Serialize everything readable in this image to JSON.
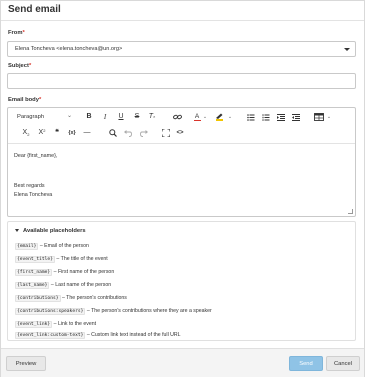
{
  "dialog": {
    "title": "Send email"
  },
  "from": {
    "label": "From",
    "required_mark": "*",
    "value": "Elena Toncheva <elena.toncheva@un.org>"
  },
  "subject": {
    "label": "Subject",
    "required_mark": "*",
    "value": ""
  },
  "body": {
    "label": "Email body",
    "required_mark": "*",
    "toolbar": {
      "paragraph": "Paragraph",
      "bold": "B",
      "italic": "I",
      "underline": "U",
      "strikethrough": "S",
      "clear_format": "T",
      "subscript": "X",
      "subscript_mark": "2",
      "superscript": "X",
      "superscript_mark": "2",
      "quote": "❝",
      "code": "{x}",
      "hr": "—",
      "source": "<>",
      "font_color_letter": "A",
      "text_color": "#d9342b",
      "highlight_color": "#f2c500"
    },
    "lines": [
      "Dear {first_name},",
      "Best regards",
      "Elena Toncheva"
    ]
  },
  "placeholders": {
    "heading": "Available placeholders",
    "items": [
      {
        "code": "{email}",
        "desc": "– Email of the person"
      },
      {
        "code": "{event_title}",
        "desc": "– The title of the event"
      },
      {
        "code": "{first_name}",
        "desc": "– First name of the person"
      },
      {
        "code": "{last_name}",
        "desc": "– Last name of the person"
      },
      {
        "code": "{contributions}",
        "desc": "– The person's contributions"
      },
      {
        "code": "{contributions:speakers}",
        "desc": "– The person's contributions where they are a speaker"
      },
      {
        "code": "{event_link}",
        "desc": "– Link to the event"
      },
      {
        "code": "{event_link:custom-text}",
        "desc": "– Custom link text instead of the full URL"
      }
    ]
  },
  "footer": {
    "preview": "Preview",
    "send": "Send",
    "cancel": "Cancel"
  }
}
